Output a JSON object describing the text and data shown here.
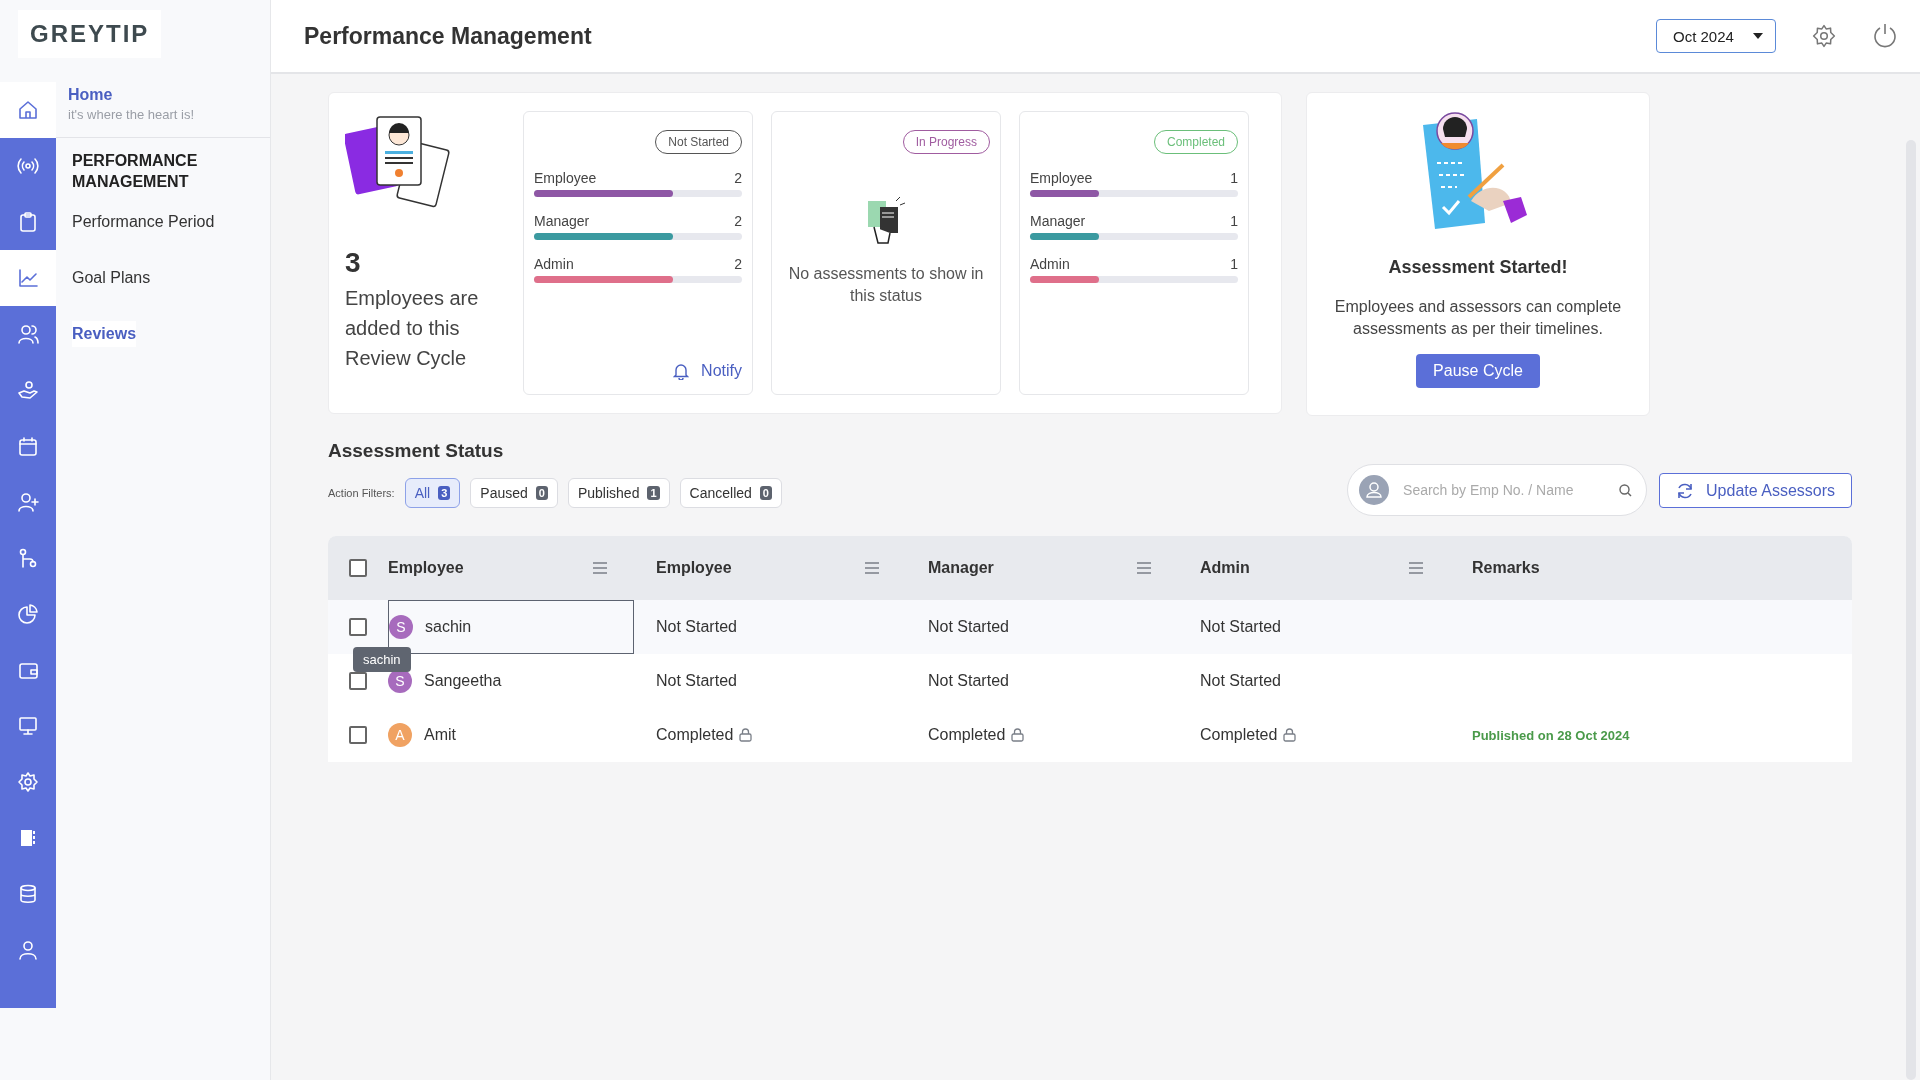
{
  "logo": {
    "text": "GREYTIP"
  },
  "rail": [
    {
      "kind": "home",
      "highlighted": true
    },
    {
      "kind": "signal",
      "highlighted": false
    },
    {
      "kind": "clipboard",
      "highlighted": false
    },
    {
      "kind": "chart",
      "highlighted": true
    },
    {
      "kind": "users",
      "highlighted": false
    },
    {
      "kind": "hand",
      "highlighted": false
    },
    {
      "kind": "calendar",
      "highlighted": false
    },
    {
      "kind": "user-plus",
      "highlighted": false
    },
    {
      "kind": "branch",
      "highlighted": false
    },
    {
      "kind": "pie",
      "highlighted": false
    },
    {
      "kind": "wallet",
      "highlighted": false
    },
    {
      "kind": "monitor",
      "highlighted": false
    },
    {
      "kind": "cog",
      "highlighted": false
    },
    {
      "kind": "book",
      "highlighted": false
    },
    {
      "kind": "database",
      "highlighted": false
    },
    {
      "kind": "user",
      "highlighted": false
    }
  ],
  "sidebar": {
    "home": {
      "label": "Home",
      "subtitle": "it's where the heart is!"
    },
    "section": "PERFORMANCE MANAGEMENT",
    "items": [
      {
        "label": "Performance Period",
        "selected": false
      },
      {
        "label": "Goal Plans",
        "selected": false
      },
      {
        "label": "Reviews",
        "selected": true
      }
    ]
  },
  "header": {
    "title": "Performance Management",
    "period": "Oct 2024"
  },
  "summary": {
    "count": "3",
    "text": "Employees are added to this Review Cycle",
    "statuses": [
      {
        "badge": "Not Started",
        "kind": "bars",
        "color": "#555555",
        "bars": [
          {
            "label": "Employee",
            "value": "2",
            "level": 0.67,
            "color": "#8e57a5"
          },
          {
            "label": "Manager",
            "value": "2",
            "level": 0.67,
            "color": "#3b9aa0"
          },
          {
            "label": "Admin",
            "value": "2",
            "level": 0.67,
            "color": "#df6f8a"
          }
        ],
        "action": "Notify"
      },
      {
        "badge": "In Progress",
        "kind": "empty",
        "color": "#a05ca0",
        "message": "No assessments to show in this status"
      },
      {
        "badge": "Completed",
        "kind": "bars",
        "color": "#6bbf7a",
        "bars": [
          {
            "label": "Employee",
            "value": "1",
            "level": 0.33,
            "color": "#8e57a5"
          },
          {
            "label": "Manager",
            "value": "1",
            "level": 0.33,
            "color": "#3b9aa0"
          },
          {
            "label": "Admin",
            "value": "1",
            "level": 0.33,
            "color": "#df6f8a"
          }
        ]
      }
    ]
  },
  "cycle": {
    "title": "Assessment Started!",
    "text": "Employees and assessors can complete assessments as per their timelines.",
    "button": "Pause Cycle"
  },
  "assessment": {
    "title": "Assessment Status",
    "filters_label": "Action Filters:",
    "filters": [
      {
        "label": "All",
        "count": "3",
        "selected": true
      },
      {
        "label": "Paused",
        "count": "0",
        "selected": false
      },
      {
        "label": "Published",
        "count": "1",
        "selected": false
      },
      {
        "label": "Cancelled",
        "count": "0",
        "selected": false
      }
    ],
    "search": {
      "placeholder": "Search by Emp No. / Name"
    },
    "update_button": "Update Assessors"
  },
  "table": {
    "select_all": {
      "checked": false
    },
    "columns": [
      {
        "label": "Employee",
        "menu": true
      },
      {
        "label": "Employee",
        "menu": true
      },
      {
        "label": "Manager",
        "menu": true
      },
      {
        "label": "Admin",
        "menu": true
      },
      {
        "label": "Remarks",
        "menu": false
      }
    ],
    "rows": [
      {
        "focused": true,
        "checked": false,
        "cells": [
          {
            "kind": "employee",
            "initial": "S",
            "name": "sachin",
            "color": "#a76bbd"
          },
          {
            "kind": "status",
            "text": "Not Started",
            "locked": false
          },
          {
            "kind": "status",
            "text": "Not Started",
            "locked": false
          },
          {
            "kind": "status",
            "text": "Not Started",
            "locked": false
          }
        ]
      },
      {
        "focused": false,
        "checked": false,
        "cells": [
          {
            "kind": "employee",
            "initial": "S",
            "name": "Sangeetha",
            "color": "#a76bbd"
          },
          {
            "kind": "status",
            "text": "Not Started",
            "locked": false
          },
          {
            "kind": "status",
            "text": "Not Started",
            "locked": false
          },
          {
            "kind": "status",
            "text": "Not Started",
            "locked": false
          }
        ]
      },
      {
        "focused": false,
        "checked": false,
        "cells": [
          {
            "kind": "employee",
            "initial": "A",
            "name": "Amit",
            "color": "#f0a262"
          },
          {
            "kind": "status",
            "text": "Completed",
            "locked": true
          },
          {
            "kind": "status",
            "text": "Completed",
            "locked": true
          },
          {
            "kind": "status",
            "text": "Completed",
            "locked": true
          },
          {
            "kind": "remarks",
            "text": "Published on 28 Oct 2024"
          }
        ]
      }
    ]
  },
  "tooltip": {
    "text": "sachin"
  }
}
